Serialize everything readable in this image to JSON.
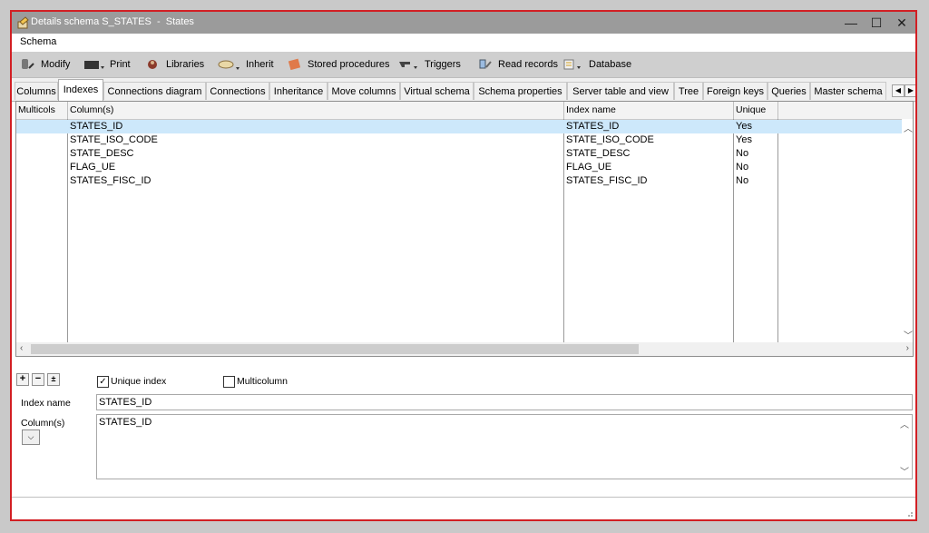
{
  "window": {
    "title": "Details schema S_STATES  -  States",
    "minimize": "—",
    "maximize": "☐",
    "close": "✕"
  },
  "menu": {
    "schema": "Schema"
  },
  "toolbar": {
    "modify": "Modify",
    "print": "Print",
    "libraries": "Libraries",
    "inherit": "Inherit",
    "stored_procedures": "Stored procedures",
    "triggers": "Triggers",
    "read_records": "Read records",
    "database": "Database"
  },
  "tabs": [
    "Columns",
    "Indexes",
    "Connections diagram",
    "Connections",
    "Inheritance",
    "Move columns",
    "Virtual schema",
    "Schema properties",
    "Server table and view",
    "Tree",
    "Foreign keys",
    "Queries",
    "Master schema"
  ],
  "grid": {
    "headers": {
      "multicols": "Multicols",
      "columns": "Column(s)",
      "index_name": "Index name",
      "unique": "Unique"
    },
    "rows": [
      {
        "columns": "STATES_ID",
        "index_name": "STATES_ID",
        "unique": "Yes"
      },
      {
        "columns": "STATE_ISO_CODE",
        "index_name": "STATE_ISO_CODE",
        "unique": "Yes"
      },
      {
        "columns": "STATE_DESC",
        "index_name": "STATE_DESC",
        "unique": "No"
      },
      {
        "columns": "FLAG_UE",
        "index_name": "FLAG_UE",
        "unique": "No"
      },
      {
        "columns": "STATES_FISC_ID",
        "index_name": "STATES_FISC_ID",
        "unique": "No"
      }
    ]
  },
  "detail": {
    "add": "+",
    "remove": "−",
    "edit": "±",
    "unique_index_label": "Unique index",
    "unique_index_checked": "✓",
    "multicolumn_label": "Multicolumn",
    "index_name_label": "Index name",
    "index_name_value": "STATES_ID",
    "columns_label": "Column(s)",
    "columns_value": "STATES_ID",
    "dropdown_arrow": "⌵"
  }
}
